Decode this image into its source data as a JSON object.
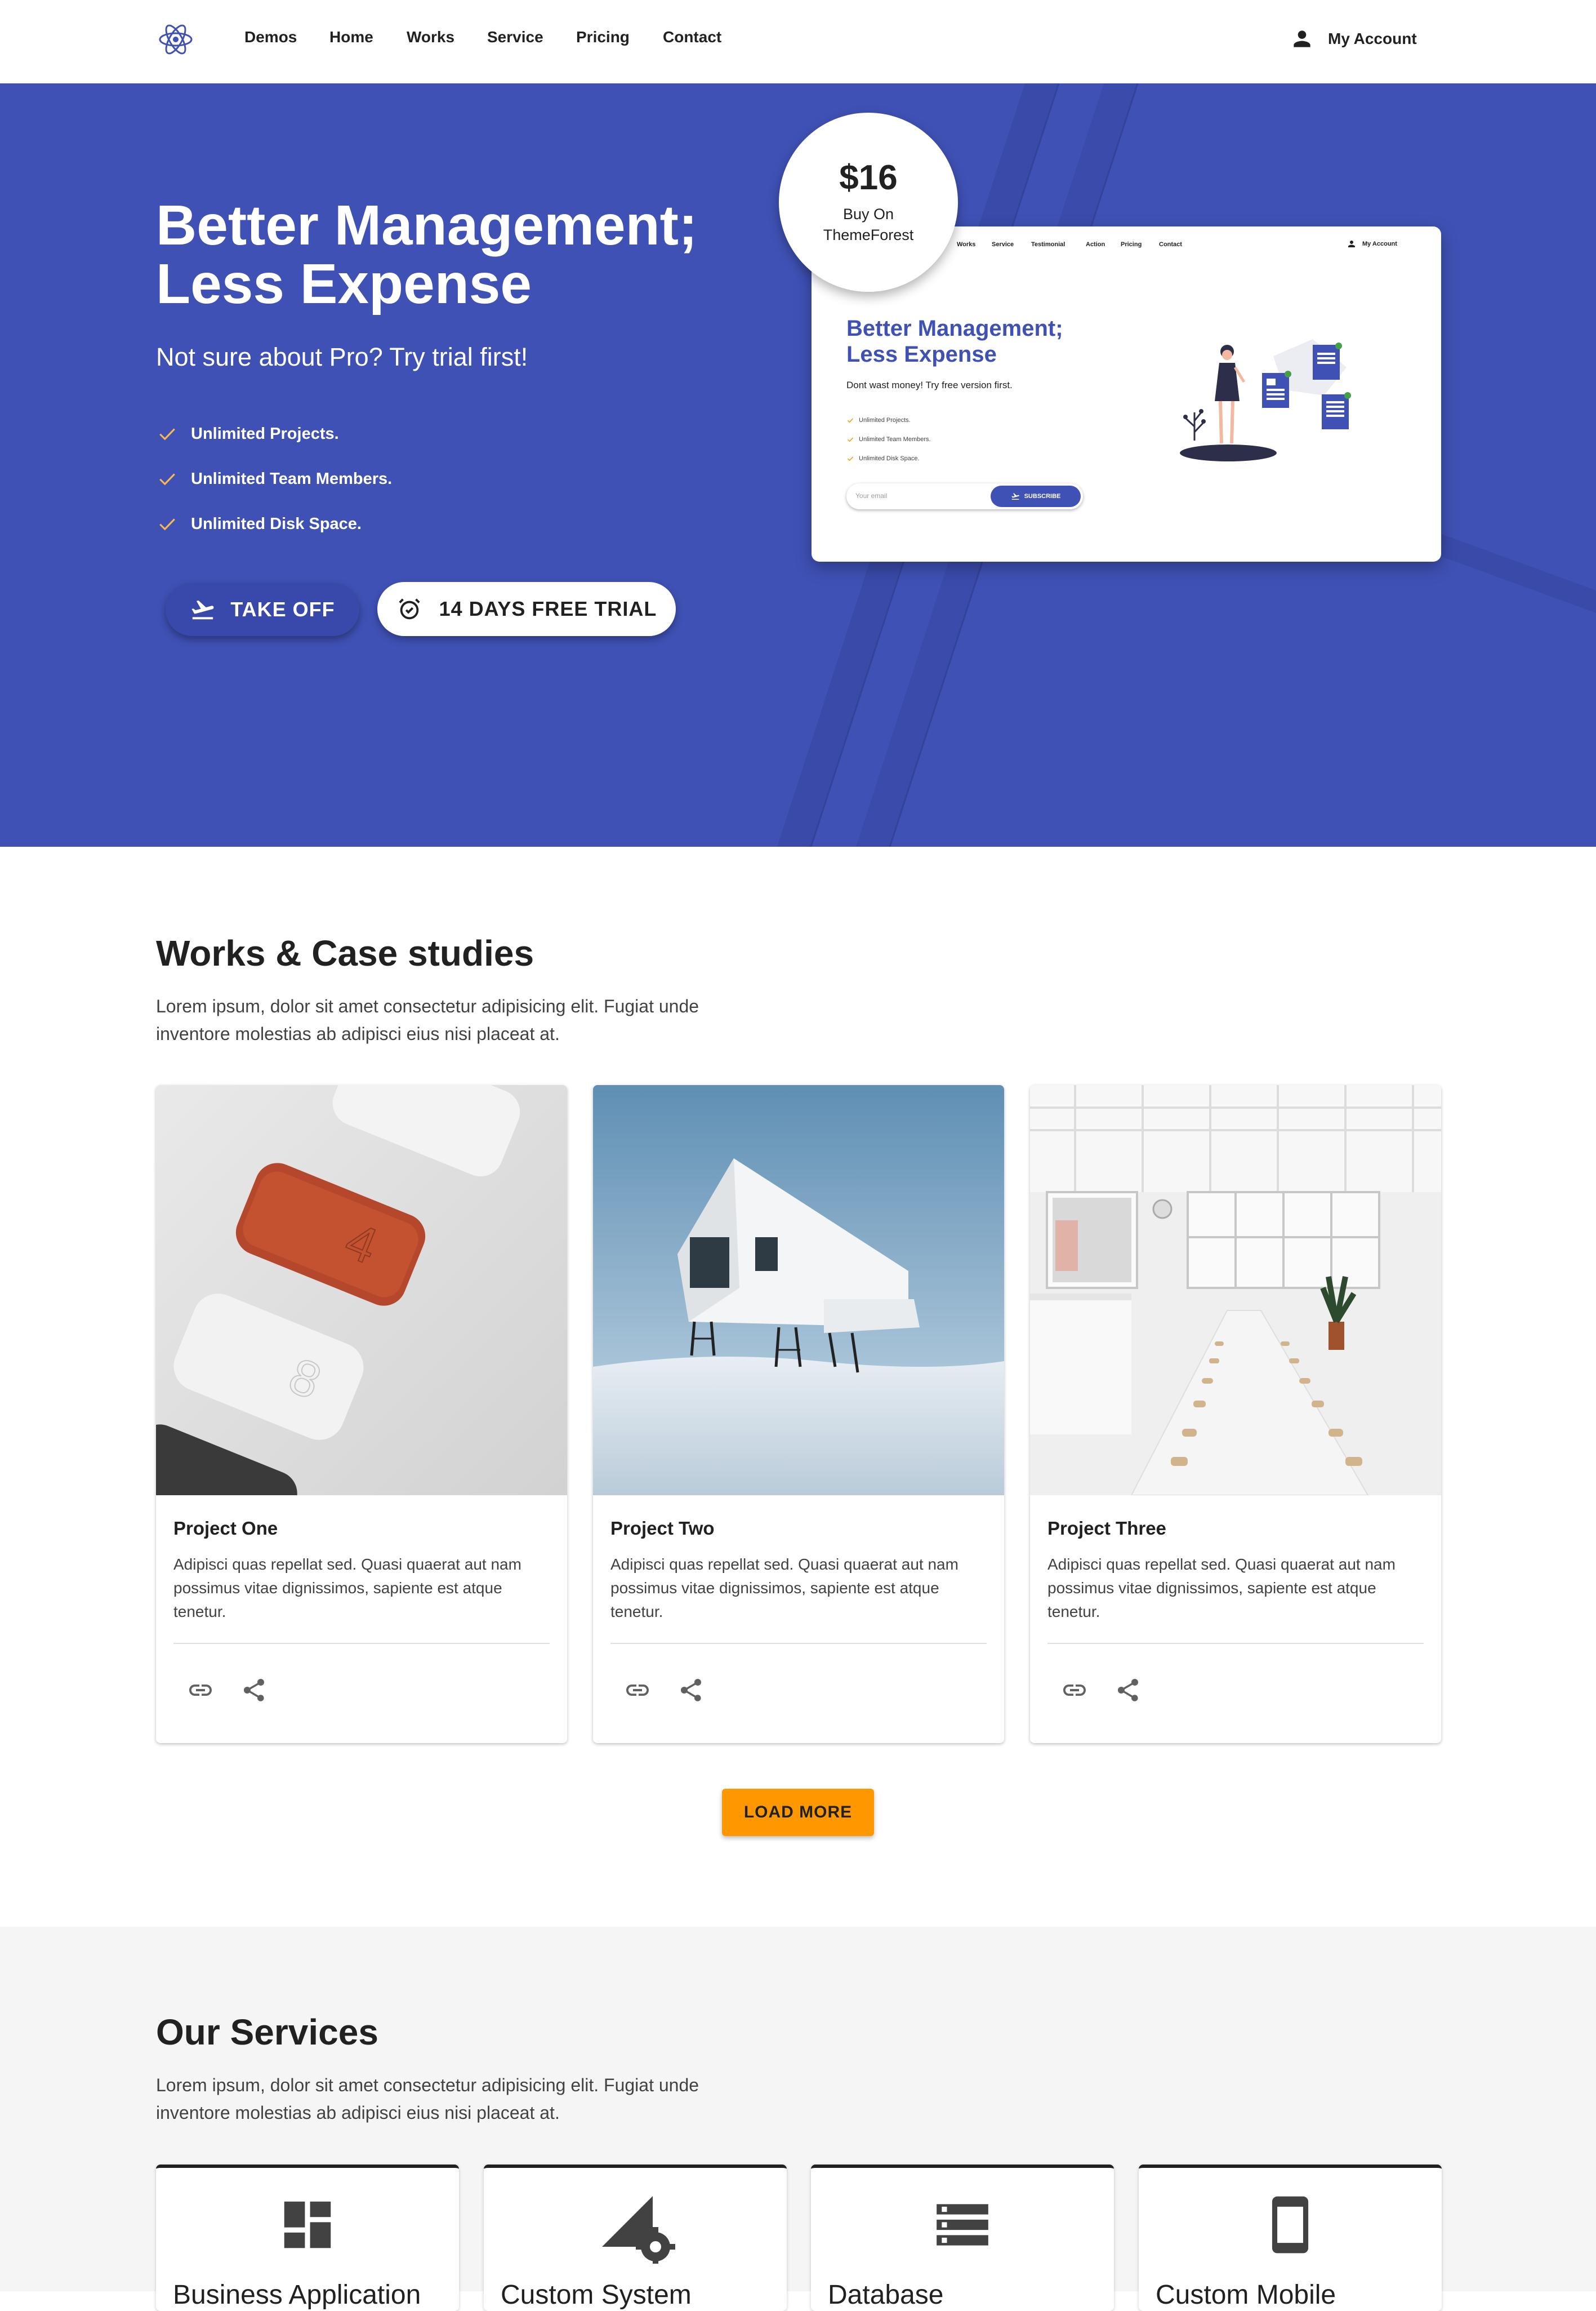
{
  "nav": {
    "logo": "atom-logo",
    "items": [
      "Demos",
      "Home",
      "Works",
      "Service",
      "Pricing",
      "Contact"
    ],
    "account_label": "My Account"
  },
  "hero": {
    "title_line1": "Better Management;",
    "title_line2": "Less Expense",
    "subtitle": "Not sure about Pro? Try trial first!",
    "features": [
      "Unlimited Projects.",
      "Unlimited Team Members.",
      "Unlimited Disk Space."
    ],
    "btn_takeoff": "TAKE OFF",
    "btn_trial": "14 DAYS FREE TRIAL",
    "colors": {
      "background": "#3f51b5",
      "check": "#ffb74d"
    }
  },
  "price_badge": {
    "price": "$16",
    "line1": "Buy On",
    "line2": "ThemeForest"
  },
  "preview": {
    "nav": [
      "Works",
      "Service",
      "Testimonial",
      "Action",
      "Pricing",
      "Contact"
    ],
    "account": "My Account",
    "title_line1": "Better Management;",
    "title_line2": "Less Expense",
    "subtitle": "Dont wast money! Try free version first.",
    "features": [
      "Unlimited Projects.",
      "Unlimited Team Members.",
      "Unlimited Disk Space."
    ],
    "email_placeholder": "Your email",
    "subscribe": "SUBSCRIBE"
  },
  "works": {
    "title": "Works & Case studies",
    "desc_line1": "Lorem ipsum, dolor sit amet consectetur adipisicing elit. Fugiat unde",
    "desc_line2": "inventore molestias ab adipisci eius nisi placeat at.",
    "cards": [
      {
        "title": "Project One",
        "text": "Adipisci quas repellat sed. Quasi quaerat aut nam possimus vitae dignissimos, sapiente est atque tenetur."
      },
      {
        "title": "Project Two",
        "text": "Adipisci quas repellat sed. Quasi quaerat aut nam possimus vitae dignissimos, sapiente est atque tenetur."
      },
      {
        "title": "Project Three",
        "text": "Adipisci quas repellat sed. Quasi quaerat aut nam possimus vitae dignissimos, sapiente est atque tenetur."
      }
    ],
    "load_more": "LOAD MORE"
  },
  "services": {
    "title": "Our Services",
    "desc_line1": "Lorem ipsum, dolor sit amet consectetur adipisicing elit. Fugiat unde",
    "desc_line2": "inventore molestias ab adipisci eius nisi placeat at.",
    "items": [
      {
        "label": "Business Application",
        "icon": "dashboard-icon"
      },
      {
        "label": "Custom System",
        "icon": "settings-cell-icon"
      },
      {
        "label": "Database",
        "icon": "storage-icon"
      },
      {
        "label": "Custom Mobile",
        "icon": "smartphone-icon"
      }
    ]
  }
}
